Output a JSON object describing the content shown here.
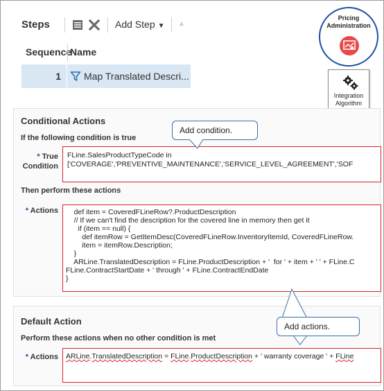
{
  "steps": {
    "title": "Steps",
    "add_step_label": "Add Step",
    "columns": [
      "Sequence",
      "Name"
    ],
    "rows": [
      {
        "sequence": "1",
        "name": "Map Translated Descri..."
      }
    ]
  },
  "badges": {
    "pricing_title": "Pricing Administration",
    "integration_label": "Integration Algorithm"
  },
  "conditional": {
    "title": "Conditional Actions",
    "if_text": "If the following condition is true",
    "true_condition_label": "True Condition",
    "condition_line1": "FLine.SalesProductTypeCode in",
    "condition_line2": "['COVERAGE','PREVENTIVE_MAINTENANCE','SERVICE_LEVEL_AGREEMENT','SOF",
    "then_text": "Then perform these actions",
    "actions_label": "Actions",
    "actions_code": "    def item = CoveredFLineRow?.ProductDescription\n    // If we can't find the description for the covered line in memory then get it\n      if (item == null) {\n        def itemRow = GetItemDesc(CoveredFLineRow.InventoryItemId, CoveredFLineRow.\n        item = itemRow.Description;\n    }\n    ARLine.TranslatedDescription = FLine.ProductDescription + '  for ' + item + ' ' + FLine.C\nFLine.ContractStartDate + ' through ' + FLine.ContractEndDate\n}"
  },
  "callouts": {
    "add_condition": "Add condition.",
    "add_actions": "Add actions."
  },
  "default_action": {
    "title": "Default Action",
    "perform_text": "Perform these actions when no other condition is met",
    "actions_label": "Actions",
    "parts": [
      "ARLine",
      ".",
      "TranslatedDescription",
      " = ",
      "FLine",
      ".",
      "ProductDescription",
      " + ' warranty coverage ' + ",
      "FLine"
    ]
  },
  "colors": {
    "highlight_border": "#d9222a",
    "callout_border": "#3a6ea5",
    "selected_row": "#d9e6f3",
    "pricing_ring": "#1e4fa3",
    "pricing_icon": "#e84a4a"
  }
}
